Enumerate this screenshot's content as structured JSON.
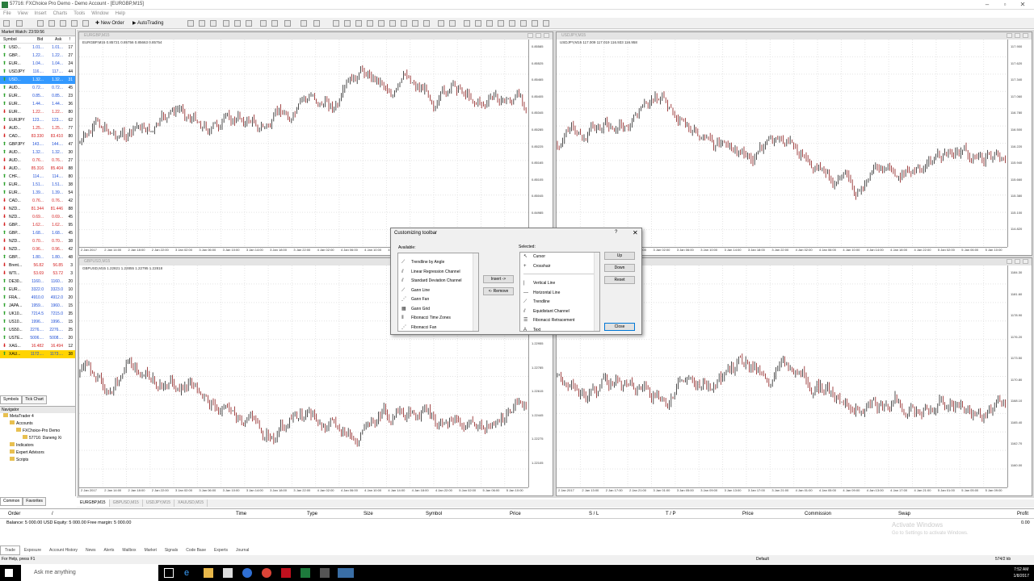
{
  "window": {
    "title": "57716: FXChoice Pro Demo - Demo Account - [EURGBP,M15]"
  },
  "menu": [
    "File",
    "View",
    "Insert",
    "Charts",
    "Tools",
    "Window",
    "Help"
  ],
  "toolbar": {
    "new_order": "New Order",
    "autotrading": "AutoTrading"
  },
  "market_watch": {
    "header": "Market Watch: 23:59:56",
    "columns": {
      "symbol": "Symbol",
      "bid": "Bid",
      "ask": "Ask",
      "spread": "!"
    },
    "rows": [
      {
        "symbol": "USD...",
        "bid": "1.01...",
        "ask": "1.01...",
        "spread": "17",
        "dir": "up"
      },
      {
        "symbol": "GBP...",
        "bid": "1.22...",
        "ask": "1.22...",
        "spread": "27",
        "dir": "up"
      },
      {
        "symbol": "EUR...",
        "bid": "1.04...",
        "ask": "1.04...",
        "spread": "24",
        "dir": "up"
      },
      {
        "symbol": "USDJPY",
        "bid": "116....",
        "ask": "117....",
        "spread": "44",
        "dir": "up"
      },
      {
        "symbol": "USD...",
        "bid": "1.32...",
        "ask": "1.32...",
        "spread": "31",
        "dir": "up"
      },
      {
        "symbol": "AUD...",
        "bid": "0.72...",
        "ask": "0.72...",
        "spread": "45",
        "dir": "up"
      },
      {
        "symbol": "EUR...",
        "bid": "0.85...",
        "ask": "0.85...",
        "spread": "23",
        "dir": "up"
      },
      {
        "symbol": "EUR...",
        "bid": "1.44...",
        "ask": "1.44...",
        "spread": "36",
        "dir": "up"
      },
      {
        "symbol": "EUR...",
        "bid": "1.22...",
        "ask": "1.22...",
        "spread": "80",
        "dir": "down"
      },
      {
        "symbol": "EURJPY",
        "bid": "123....",
        "ask": "123....",
        "spread": "62",
        "dir": "up"
      },
      {
        "symbol": "AUD...",
        "bid": "1.25...",
        "ask": "1.25...",
        "spread": "77",
        "dir": "down"
      },
      {
        "symbol": "CAD...",
        "bid": "83.330",
        "ask": "83.410",
        "spread": "80",
        "dir": "down"
      },
      {
        "symbol": "GBPJPY",
        "bid": "143....",
        "ask": "144....",
        "spread": "47",
        "dir": "up"
      },
      {
        "symbol": "AUD...",
        "bid": "1.32...",
        "ask": "1.32...",
        "spread": "30",
        "dir": "up"
      },
      {
        "symbol": "AUD...",
        "bid": "0.76...",
        "ask": "0.76...",
        "spread": "27",
        "dir": "down"
      },
      {
        "symbol": "AUD...",
        "bid": "85.316",
        "ask": "85.404",
        "spread": "88",
        "dir": "down"
      },
      {
        "symbol": "CHF...",
        "bid": "114....",
        "ask": "114....",
        "spread": "80",
        "dir": "up"
      },
      {
        "symbol": "EUR...",
        "bid": "1.51...",
        "ask": "1.51...",
        "spread": "38",
        "dir": "up"
      },
      {
        "symbol": "EUR...",
        "bid": "1.39...",
        "ask": "1.39...",
        "spread": "54",
        "dir": "up"
      },
      {
        "symbol": "CAD...",
        "bid": "0.76...",
        "ask": "0.76...",
        "spread": "42",
        "dir": "down"
      },
      {
        "symbol": "NZD...",
        "bid": "81.344",
        "ask": "81.446",
        "spread": "88",
        "dir": "down"
      },
      {
        "symbol": "NZD...",
        "bid": "0.69...",
        "ask": "0.69...",
        "spread": "45",
        "dir": "down"
      },
      {
        "symbol": "GBP...",
        "bid": "1.62...",
        "ask": "1.62...",
        "spread": "95",
        "dir": "down"
      },
      {
        "symbol": "GBP...",
        "bid": "1.68...",
        "ask": "1.68...",
        "spread": "45",
        "dir": "up"
      },
      {
        "symbol": "NZD...",
        "bid": "0.70...",
        "ask": "0.70...",
        "spread": "38",
        "dir": "down"
      },
      {
        "symbol": "NZD...",
        "bid": "0.96...",
        "ask": "0.96...",
        "spread": "42",
        "dir": "down"
      },
      {
        "symbol": "GBP...",
        "bid": "1.80...",
        "ask": "1.80...",
        "spread": "48",
        "dir": "up"
      },
      {
        "symbol": "Brent...",
        "bid": "56.82",
        "ask": "56.85",
        "spread": "3",
        "dir": "down"
      },
      {
        "symbol": "WTI...",
        "bid": "53.69",
        "ask": "53.72",
        "spread": "3",
        "dir": "down"
      },
      {
        "symbol": "DE30...",
        "bid": "1160...",
        "ask": "1160...",
        "spread": "20",
        "dir": "up"
      },
      {
        "symbol": "EUR...",
        "bid": "3322.0",
        "ask": "3323.0",
        "spread": "10",
        "dir": "up"
      },
      {
        "symbol": "FRA...",
        "bid": "4910.0",
        "ask": "4912.0",
        "spread": "20",
        "dir": "up"
      },
      {
        "symbol": "JAPA...",
        "bid": "1959...",
        "ask": "1960...",
        "spread": "15",
        "dir": "up"
      },
      {
        "symbol": "UK10...",
        "bid": "7214.5",
        "ask": "7215.0",
        "spread": "35",
        "dir": "up"
      },
      {
        "symbol": "US10...",
        "bid": "1996...",
        "ask": "1996...",
        "spread": "15",
        "dir": "up"
      },
      {
        "symbol": "US50...",
        "bid": "2276....",
        "ask": "2276....",
        "spread": "25",
        "dir": "up"
      },
      {
        "symbol": "USTE...",
        "bid": "5006....",
        "ask": "5008....",
        "spread": "20",
        "dir": "up"
      },
      {
        "symbol": "XAG...",
        "bid": "16.482",
        "ask": "16.494",
        "spread": "12",
        "dir": "down"
      },
      {
        "symbol": "XAU...",
        "bid": "1172....",
        "ask": "1173....",
        "spread": "38",
        "dir": "up"
      }
    ],
    "tabs": [
      "Symbols",
      "Tick Chart"
    ]
  },
  "navigator": {
    "header": "Navigator",
    "items": [
      {
        "label": "MetaTrader 4",
        "level": 0
      },
      {
        "label": "Accounts",
        "level": 1
      },
      {
        "label": "FXChoice-Pro Demo",
        "level": 2
      },
      {
        "label": "57716: Daneng Xi",
        "level": 3
      },
      {
        "label": "Indicators",
        "level": 1
      },
      {
        "label": "Expert Advisors",
        "level": 1
      },
      {
        "label": "Scripts",
        "level": 1
      }
    ],
    "tabs": [
      "Common",
      "Favorites"
    ]
  },
  "charts": [
    {
      "title": "EURGBP,M15",
      "info": "EURGBP,M15  0.85721 0.85756 0.85663 0.85754",
      "prices": [
        "0.85585",
        "0.85525",
        "0.85465",
        "0.85405",
        "0.85345",
        "0.85285",
        "0.85225",
        "0.85165",
        "0.85105",
        "0.85045",
        "0.84985",
        "0.84925"
      ],
      "times": [
        "2 Jan 2017",
        "2 Jan 14:00",
        "2 Jan 18:00",
        "2 Jan 22:00",
        "3 Jan 02:00",
        "3 Jan 06:00",
        "3 Jan 10:00",
        "3 Jan 14:00",
        "3 Jan 18:00",
        "3 Jan 22:00",
        "4 Jan 02:00",
        "4 Jan 06:00",
        "4 Jan 10:00",
        "4 Jan 14:00",
        "4 Jan 18:00",
        "4 Jan 22:00",
        "5 Jan 02:00",
        "5 Jan 06:00",
        "5 Jan 10:00"
      ]
    },
    {
      "title": "USDJPY,M15",
      "info": "USDJPY,M15  117.009 117.019 116.933 116.958",
      "prices": [
        "117.900",
        "117.620",
        "117.340",
        "117.060",
        "116.780",
        "116.500",
        "116.220",
        "115.940",
        "115.660",
        "115.380",
        "115.100",
        "114.820"
      ],
      "times": [
        "2 Jan 2017",
        "2 Jan 14:00",
        "2 Jan 18:00",
        "2 Jan 22:00",
        "3 Jan 02:00",
        "3 Jan 06:00",
        "3 Jan 10:00",
        "3 Jan 14:00",
        "3 Jan 18:00",
        "3 Jan 22:00",
        "4 Jan 02:00",
        "4 Jan 06:00",
        "4 Jan 10:00",
        "4 Jan 14:00",
        "4 Jan 18:00",
        "4 Jan 22:00",
        "5 Jan 02:00",
        "5 Jan 06:00",
        "5 Jan 10:00"
      ]
    },
    {
      "title": "GBPUSD,M15",
      "info": "GBPUSD,M15  1.22821 1.22855 1.22795 1.22818",
      "prices": [
        "1.23465",
        "1.23295",
        "1.23125",
        "1.22955",
        "1.22785",
        "1.22615",
        "1.22445",
        "1.22275",
        "1.22105"
      ],
      "times": [
        "2 Jan 2017",
        "2 Jan 14:00",
        "2 Jan 18:00",
        "2 Jan 22:00",
        "3 Jan 02:00",
        "3 Jan 06:00",
        "3 Jan 10:00",
        "3 Jan 14:00",
        "3 Jan 18:00",
        "3 Jan 22:00",
        "4 Jan 02:00",
        "4 Jan 06:00",
        "4 Jan 10:00",
        "4 Jan 14:00",
        "4 Jan 18:00",
        "4 Jan 22:00",
        "5 Jan 02:00",
        "5 Jan 06:00",
        "5 Jan 10:00"
      ]
    },
    {
      "title": "XAUUSD,M15",
      "info": "",
      "prices": [
        "1184.30",
        "1181.60",
        "1178.90",
        "1176.20",
        "1173.50",
        "1170.80",
        "1168.10",
        "1165.40",
        "1162.70",
        "1160.00"
      ],
      "times": [
        "2 Jan 2017",
        "2 Jan 13:00",
        "2 Jan 17:00",
        "2 Jan 21:00",
        "3 Jan 01:00",
        "3 Jan 05:00",
        "3 Jan 09:00",
        "3 Jan 13:00",
        "3 Jan 17:00",
        "3 Jan 21:00",
        "4 Jan 01:00",
        "4 Jan 05:00",
        "4 Jan 09:00",
        "4 Jan 13:00",
        "4 Jan 17:00",
        "4 Jan 21:00",
        "5 Jan 01:00",
        "5 Jan 05:00",
        "5 Jan 09:00"
      ]
    }
  ],
  "chart_tabs": [
    "EURGBP,M15",
    "GBPUSD,M15",
    "USDJPY,M15",
    "XAUUSD,M15"
  ],
  "dialog": {
    "title": "Customizing toolbar",
    "help": "?",
    "close_x": "✕",
    "available_label": "Available:",
    "selected_label": "Selected:",
    "available": [
      {
        "label": "Trendline by Angle",
        "icon": "⟋"
      },
      {
        "label": "Linear Regression Channel",
        "icon": "⫽"
      },
      {
        "label": "Standard Deviation Channel",
        "icon": "⫽"
      },
      {
        "label": "Gann Line",
        "icon": "⟋"
      },
      {
        "label": "Gann Fan",
        "icon": "⋰"
      },
      {
        "label": "Gann Grid",
        "icon": "▦"
      },
      {
        "label": "Fibonacci Time Zones",
        "icon": "⦀"
      },
      {
        "label": "Fibonacci Fan",
        "icon": "⋰"
      }
    ],
    "selected": [
      {
        "label": "Cursor",
        "icon": "↖"
      },
      {
        "label": "Crosshair",
        "icon": "+"
      },
      {
        "label": "",
        "icon": ""
      },
      {
        "label": "Vertical Line",
        "icon": "|"
      },
      {
        "label": "Horizontal Line",
        "icon": "—"
      },
      {
        "label": "Trendline",
        "icon": "⟋"
      },
      {
        "label": "Equidistant Channel",
        "icon": "⫽"
      },
      {
        "label": "Fibonacci Retracement",
        "icon": "☰"
      },
      {
        "label": "Text",
        "icon": "A"
      }
    ],
    "insert": "Insert ->",
    "remove": "<- Remove",
    "up": "Up",
    "down": "Down",
    "reset": "Reset",
    "close": "Close"
  },
  "terminal": {
    "columns": [
      "Order",
      "/",
      "Time",
      "Type",
      "Size",
      "Symbol",
      "Price",
      "S / L",
      "T / P",
      "Price",
      "Commission",
      "Swap",
      "Profit"
    ],
    "balance": "Balance: 5 000.00 USD  Equity: 5 000.00  Free margin: 5 000.00",
    "balance_value": "0.00",
    "tabs": [
      "Trade",
      "Exposure",
      "Account History",
      "News",
      "Alerts",
      "Mailbox",
      "Market",
      "Signals",
      "Code Base",
      "Experts",
      "Journal"
    ],
    "watermark": "Activate Windows",
    "watermark_sub": "Go to Settings to activate Windows."
  },
  "status": {
    "help": "For Help, press F1",
    "profile": "Default",
    "traffic": "574/2 kb"
  },
  "taskbar": {
    "search": "Ask me anything",
    "time": "7:52 AM",
    "date": "1/8/2017"
  }
}
